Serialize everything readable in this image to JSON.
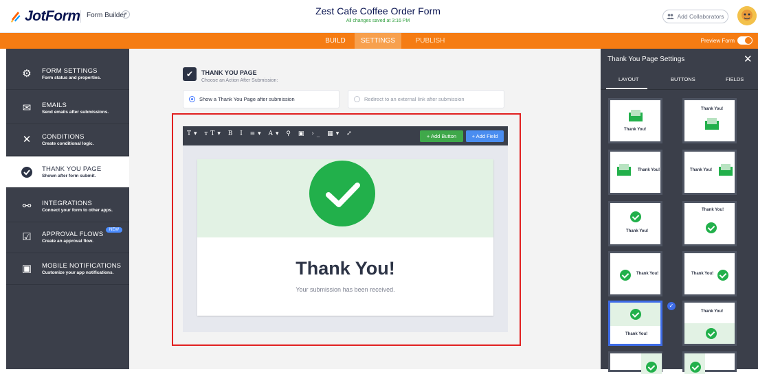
{
  "header": {
    "logo_text": "JotForm",
    "builder_label": "Form Builder",
    "form_title": "Zest Cafe Coffee Order Form",
    "saved_status": "All changes saved at 3:16 PM",
    "collaborators_label": "Add Collaborators"
  },
  "nav": {
    "tabs": [
      "BUILD",
      "SETTINGS",
      "PUBLISH"
    ],
    "active": "SETTINGS",
    "preview_label": "Preview Form"
  },
  "sidebar": {
    "items": [
      {
        "title": "FORM SETTINGS",
        "sub": "Form status and properties.",
        "icon": "gear-icon"
      },
      {
        "title": "EMAILS",
        "sub": "Send emails after submissions.",
        "icon": "envelope-icon"
      },
      {
        "title": "CONDITIONS",
        "sub": "Create conditional logic.",
        "icon": "shuffle-icon"
      },
      {
        "title": "THANK YOU PAGE",
        "sub": "Shown after form submit.",
        "icon": "check-circle-icon"
      },
      {
        "title": "INTEGRATIONS",
        "sub": "Connect your form to other apps.",
        "icon": "link-icon"
      },
      {
        "title": "APPROVAL FLOWS",
        "sub": "Create an approval flow.",
        "icon": "approval-icon"
      },
      {
        "title": "MOBILE NOTIFICATIONS",
        "sub": "Customize your app notifications.",
        "icon": "mobile-notification-icon"
      }
    ],
    "new_badge": "NEW"
  },
  "main": {
    "section_title": "THANK YOU PAGE",
    "section_sub": "Choose an Action After Submission:",
    "option_show": "Show a Thank You Page after submission",
    "option_redirect": "Redirect to an external link after submission",
    "add_button_label": "+ Add Button",
    "add_field_label": "+ Add Field",
    "thank_you_heading": "Thank You!",
    "thank_you_message": "Your submission has been received."
  },
  "panel": {
    "title": "Thank You Page Settings",
    "tabs": [
      "LAYOUT",
      "BUTTONS",
      "FIELDS"
    ],
    "thumb_text": "Thank You!"
  },
  "colors": {
    "accent_orange": "#f57c13",
    "success_green": "#22b04b",
    "sidebar_dark": "#3b3f4a",
    "primary_blue": "#4a8df0"
  }
}
